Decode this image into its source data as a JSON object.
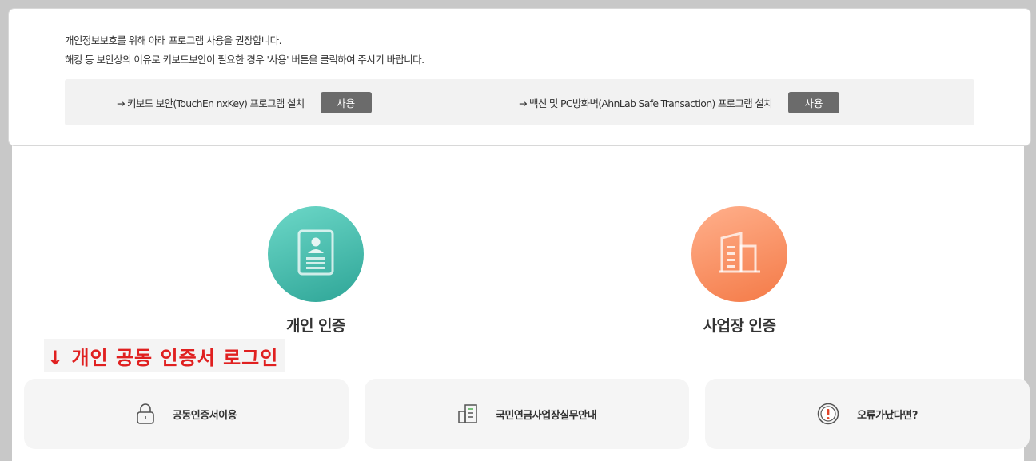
{
  "notice": {
    "line1": "개인정보보호를 위해 아래 프로그램 사용을 권장합니다.",
    "line2": "해킹 등 보안상의 이유로 키보드보안이 필요한 경우 '사용' 버튼을 클릭하여 주시기 바랍니다."
  },
  "programs": [
    {
      "label": "→ 키보드 보안(TouchEn nxKey) 프로그램 설치",
      "button": "사용"
    },
    {
      "label": "→ 백신 및 PC방화벽(AhnLab Safe Transaction) 프로그램 설치",
      "button": "사용"
    }
  ],
  "auth": {
    "personal": {
      "label": "개인 인증",
      "icon": "id-card-icon"
    },
    "business": {
      "label": "사업장 인증",
      "icon": "building-icon"
    }
  },
  "annotation": "↓ 개인 공동 인증서 로그인",
  "cards": [
    {
      "label": "공동인증서이용",
      "icon": "lock-icon"
    },
    {
      "label": "국민연금사업장실무안내",
      "icon": "document-building-icon"
    },
    {
      "label": "오류가났다면?",
      "icon": "warning-icon"
    }
  ],
  "colors": {
    "teal": "#2ea597",
    "orange": "#f47a47",
    "annotation_red": "#e02020",
    "button_gray": "#6b6b6b"
  }
}
